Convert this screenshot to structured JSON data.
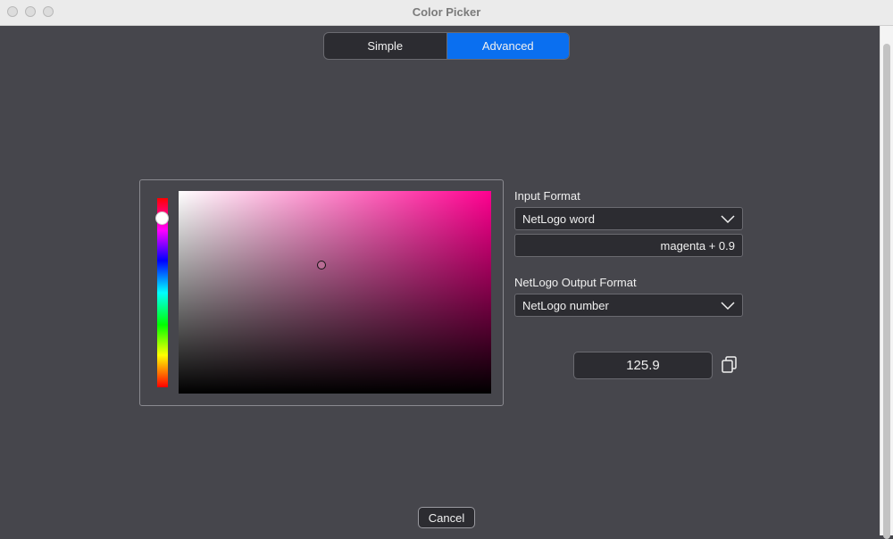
{
  "window": {
    "title": "Color Picker"
  },
  "mode_tabs": [
    {
      "label": "Simple",
      "active": false
    },
    {
      "label": "Advanced",
      "active": true
    }
  ],
  "picker": {
    "hue_level": 0.1,
    "saturation": 0.46,
    "brightness": 0.64
  },
  "input_format": {
    "label": "Input Format",
    "selected": "NetLogo word",
    "value": "magenta + 0.9"
  },
  "output_format": {
    "label": "NetLogo Output Format",
    "selected": "NetLogo number",
    "value": "125.9"
  },
  "footer": {
    "cancel_label": "Cancel"
  },
  "colors": {
    "background": "#46464c",
    "accent": "#0a6ff0",
    "field": "#2c2c31"
  },
  "icons": [
    "chevron-down-icon",
    "copy-icon"
  ]
}
